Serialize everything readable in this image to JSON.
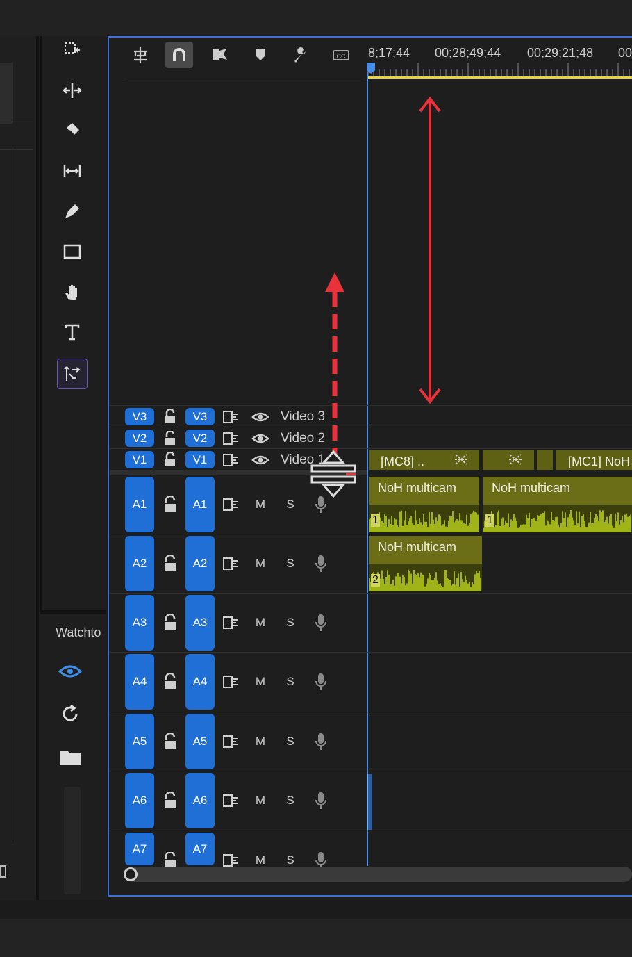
{
  "timeline": {
    "timecodes": [
      "8;17;44",
      "00;28;49;44",
      "00;29;21;48",
      "00"
    ],
    "video_tracks": [
      {
        "id": "V3",
        "target": "V3",
        "name": "Video 3"
      },
      {
        "id": "V2",
        "target": "V2",
        "name": "Video 2"
      },
      {
        "id": "V1",
        "target": "V1",
        "name": "Video 1"
      }
    ],
    "audio_tracks": [
      {
        "id": "A1",
        "target": "A1",
        "m": "M",
        "s": "S"
      },
      {
        "id": "A2",
        "target": "A2",
        "m": "M",
        "s": "S"
      },
      {
        "id": "A3",
        "target": "A3",
        "m": "M",
        "s": "S"
      },
      {
        "id": "A4",
        "target": "A4",
        "m": "M",
        "s": "S"
      },
      {
        "id": "A5",
        "target": "A5",
        "m": "M",
        "s": "S"
      },
      {
        "id": "A6",
        "target": "A6",
        "m": "M",
        "s": "S"
      },
      {
        "id": "A7",
        "target": "A7",
        "m": "M",
        "s": "S"
      }
    ],
    "clips": {
      "v1": [
        "[MC8] ..",
        "[MC1] NoH"
      ],
      "a1": [
        "NoH multicam",
        "NoH multicam"
      ],
      "a1_channels": [
        "1",
        "1"
      ],
      "a2": [
        "NoH multicam"
      ],
      "a2_channels": [
        "2"
      ]
    },
    "toolbar_icons": [
      "nest-icon",
      "snap-icon",
      "linked-selection-icon",
      "marker-icon",
      "wrench-icon",
      "captions-icon"
    ]
  },
  "tools": [
    "track-select-icon",
    "ripple-edit-icon",
    "razor-icon",
    "slip-icon",
    "pen-icon",
    "rectangle-icon",
    "hand-icon",
    "type-icon",
    "remix-icon"
  ],
  "watch_panel": {
    "title": "Watchto"
  },
  "colors": {
    "accent": "#1f6fd6",
    "clip": "#6c6e17",
    "waveform": "#b9d21d",
    "playhead": "#4a8de6",
    "work_area": "#e8d23a",
    "annotation": "#e8333a"
  }
}
